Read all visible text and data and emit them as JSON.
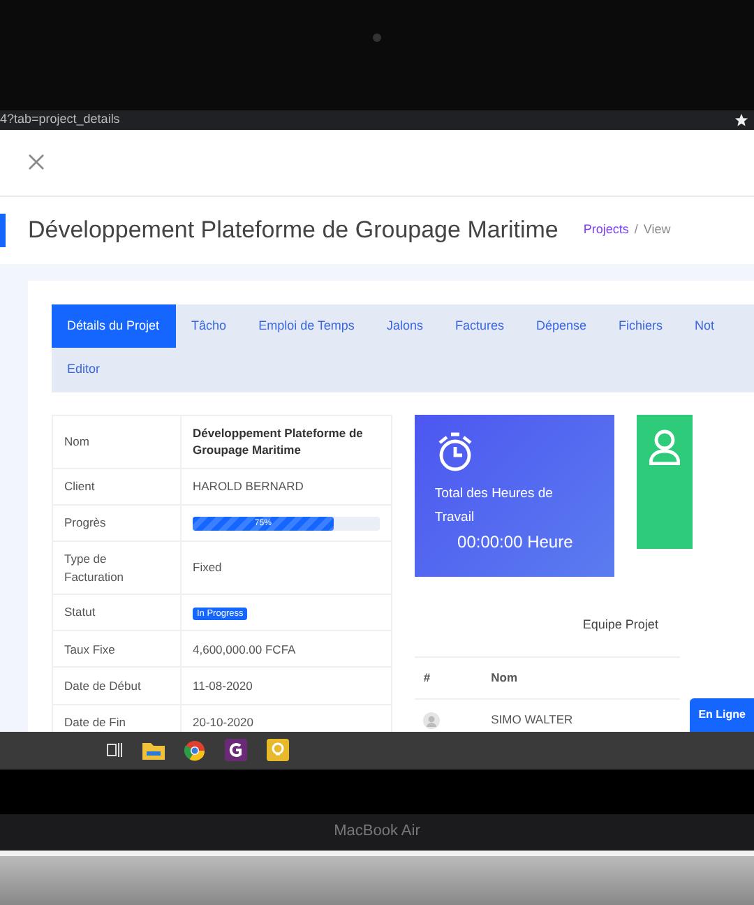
{
  "browser": {
    "url": "4?tab=project_details"
  },
  "page": {
    "title": "Développement Plateforme de Groupage Maritime",
    "breadcrumb": [
      {
        "label": "Projects",
        "link": true
      },
      {
        "label": "View",
        "link": false
      }
    ],
    "breadcrumb_separator": "/"
  },
  "tabs": [
    {
      "label": "Détails du Projet",
      "selected": true
    },
    {
      "label": "Tâcho",
      "selected": false
    },
    {
      "label": "Emploi de Temps",
      "selected": false
    },
    {
      "label": "Jalons",
      "selected": false
    },
    {
      "label": "Factures",
      "selected": false
    },
    {
      "label": "Dépense",
      "selected": false
    },
    {
      "label": "Fichiers",
      "selected": false
    },
    {
      "label": "Not",
      "selected": false
    },
    {
      "label": "Editor",
      "selected": false
    }
  ],
  "details": [
    {
      "label": "Nom",
      "kind": "bold",
      "value": "Développement Plateforme de Groupage Maritime"
    },
    {
      "label": "Client",
      "kind": "text",
      "value": "HAROLD BERNARD"
    },
    {
      "label": "Progrès",
      "kind": "progress",
      "value": "75%",
      "level": 0.75
    },
    {
      "label": "Type de Facturation",
      "kind": "text",
      "value": "Fixed"
    },
    {
      "label": "Statut",
      "kind": "badge",
      "value": "In Progress"
    },
    {
      "label": "Taux Fixe",
      "kind": "text",
      "value": "4,600,000.00 FCFA"
    },
    {
      "label": "Date de Début",
      "kind": "text",
      "value": "11-08-2020"
    },
    {
      "label": "Date de Fin",
      "kind": "text",
      "value": "20-10-2020"
    }
  ],
  "hours_card": {
    "title": "Total des Heures de Travail",
    "value": "00:00:00 Heure"
  },
  "team": {
    "title": "Equipe Projet",
    "columns": [
      "#",
      "Nom"
    ],
    "members": [
      {
        "name": "SIMO WALTER"
      }
    ]
  },
  "chat_button": {
    "label": "En Ligne"
  },
  "laptop": {
    "label": "MacBook Air"
  }
}
